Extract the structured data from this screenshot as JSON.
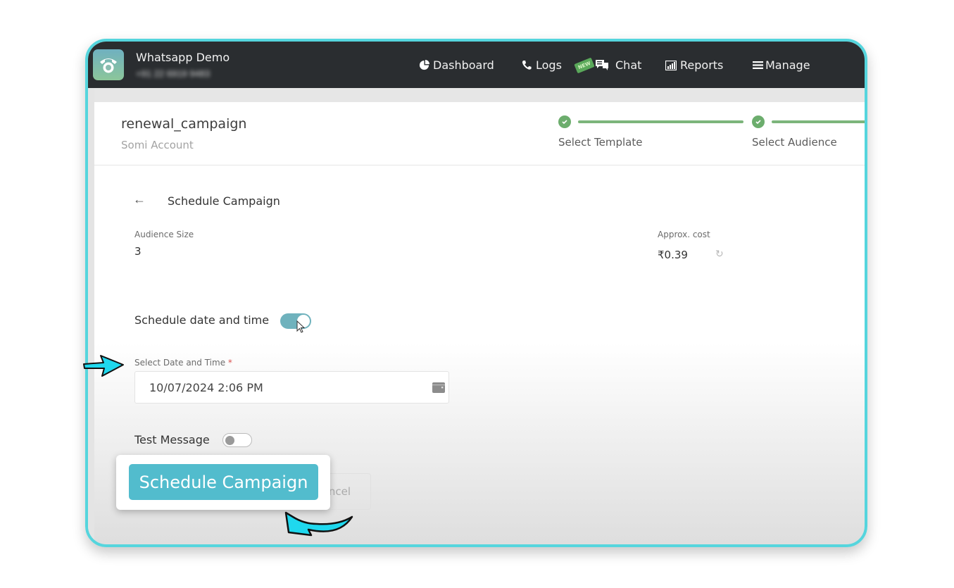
{
  "app": {
    "title": "Whatsapp Demo",
    "phone": "+91 22 6919 9483"
  },
  "nav": {
    "dashboard": "Dashboard",
    "logs": "Logs",
    "new_badge": "NEW",
    "chat": "Chat",
    "reports": "Reports",
    "manage": "Manage"
  },
  "campaign": {
    "name": "renewal_campaign",
    "account": "Somi Account"
  },
  "steps": [
    {
      "label": "Select Template",
      "status": "complete"
    },
    {
      "label": "Select Audience",
      "status": "complete"
    }
  ],
  "schedule": {
    "back_icon": "arrow-left-icon",
    "title": "Schedule Campaign",
    "audience_label": "Audience Size",
    "audience_value": "3",
    "cost_label": "Approx. cost",
    "cost_value": "₹0.39",
    "schedule_toggle_label": "Schedule date and time",
    "schedule_toggle_on": true,
    "date_label": "Select Date and Time",
    "required_mark": "*",
    "date_value": "10/07/2024 2:06 PM",
    "test_message_label": "Test Message",
    "test_message_on": false,
    "submit_label": "Schedule Campaign",
    "cancel_label": "Cancel",
    "cancel_visible_text": "ncel"
  },
  "colors": {
    "frame_border": "#55d5dd",
    "topbar": "#2a2d30",
    "step_green": "#6cad6d",
    "toggle_on": "#6fb2bd",
    "cta": "#52bccd",
    "annotation_arrow": "#1fd8ee"
  }
}
